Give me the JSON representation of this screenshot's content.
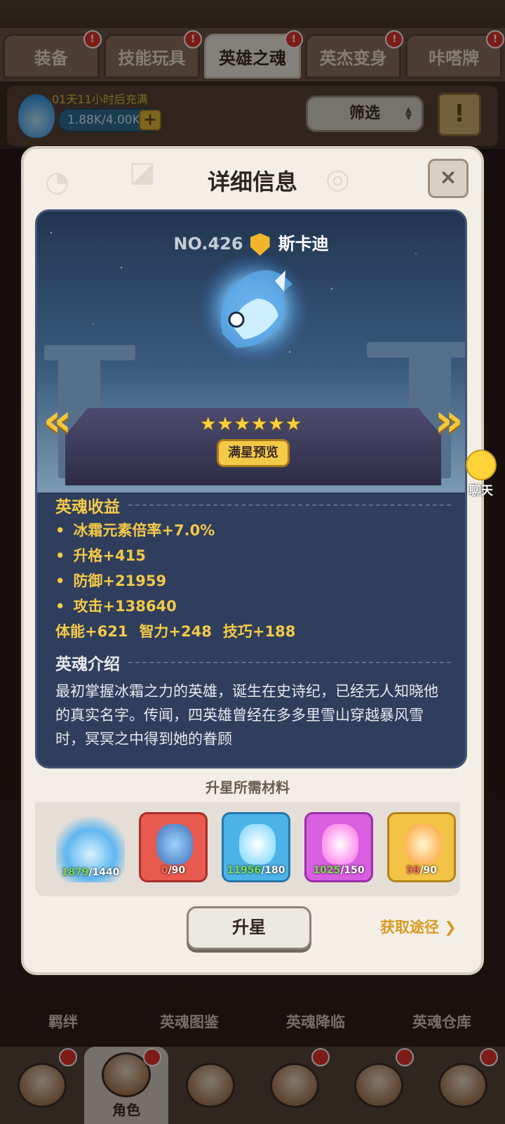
{
  "tabs": [
    {
      "label": "装备",
      "active": false
    },
    {
      "label": "技能玩具",
      "active": false
    },
    {
      "label": "英雄之魂",
      "active": true
    },
    {
      "label": "英杰变身",
      "active": false
    },
    {
      "label": "咔嗒牌",
      "active": false
    }
  ],
  "resource": {
    "timer": "01天11小时后充满",
    "amount": "1.88K/4.00K",
    "plus": "+"
  },
  "filter_label": "筛选",
  "modal": {
    "title": "详细信息",
    "close": "×",
    "hero": {
      "number": "NO.426",
      "name": "斯卡迪",
      "stars": "★★★★★★",
      "preview_label": "满星预览"
    },
    "benefits_title": "英魂收益",
    "benefits": [
      "冰霜元素倍率+7.0%",
      "升格+415",
      "防御+21959",
      "攻击+138640"
    ],
    "attributes": [
      "体能+621",
      "智力+248",
      "技巧+188"
    ],
    "intro_title": "英魂介绍",
    "intro_text": "最初掌握冰霜之力的英雄，诞生在史诗纪，已经无人知晓他的真实名字。传闻，四英雄曾经在多多里雪山穿越暴风雪时，冥冥之中得到她的眷顾",
    "materials_title": "升星所需材料",
    "materials": [
      {
        "have": "1879",
        "need": "/1440",
        "enough": true
      },
      {
        "have": "0",
        "need": "/90",
        "enough": false
      },
      {
        "have": "11956",
        "need": "/180",
        "enough": true
      },
      {
        "have": "1025",
        "need": "/150",
        "enough": true
      },
      {
        "have": "58",
        "need": "/90",
        "enough": false
      }
    ],
    "upgrade_label": "升星",
    "acquire_label": "获取途径 ❯",
    "left_arrow": "«",
    "right_arrow": "»"
  },
  "chat_label": "聊天",
  "func_row": [
    "羁绊",
    "英魂图鉴",
    "英魂降临",
    "英魂仓库"
  ],
  "bottom_nav": {
    "active_label": "角色"
  },
  "colors": {
    "accent_gold": "#f3c948",
    "ok_green": "#7bdd52",
    "warn_red": "#ff6b5b"
  }
}
